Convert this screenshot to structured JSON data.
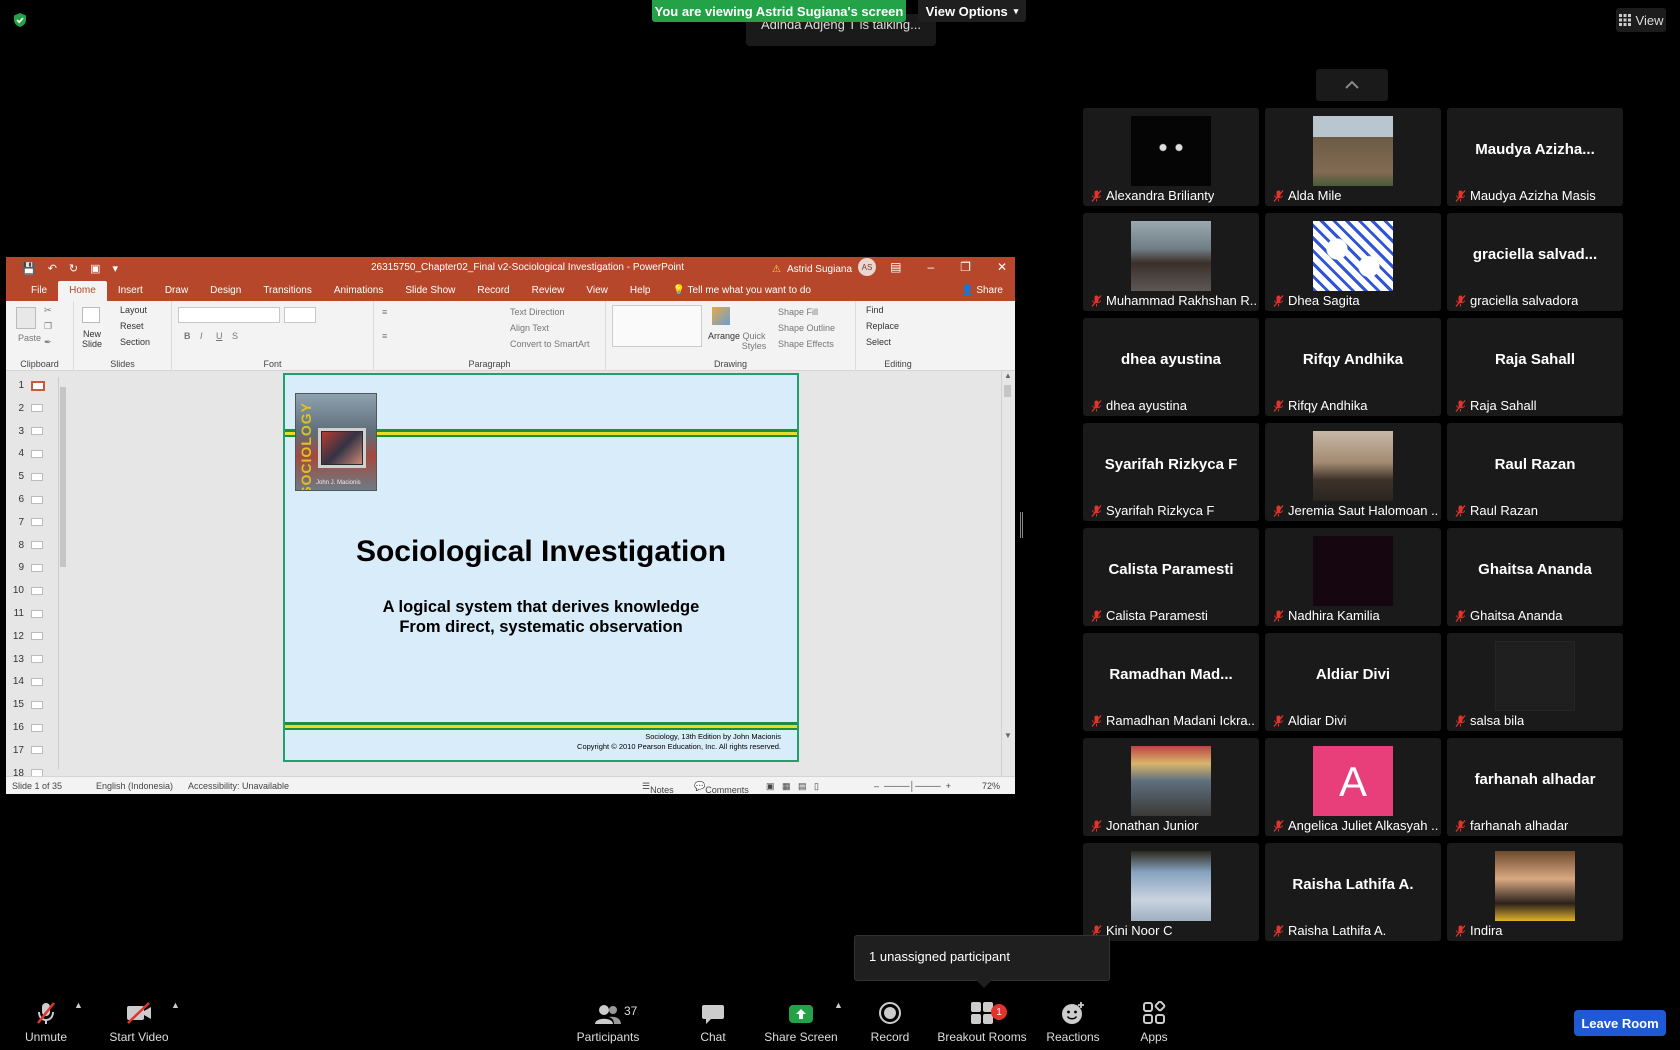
{
  "top": {
    "banner": "You are viewing Astrid Sugiana's screen",
    "view_options": "View Options",
    "talking": "Adinda Adjeng T is talking...",
    "view_label": "View"
  },
  "ppt": {
    "doc_title": "26315750_Chapter02_Final v2-Sociological Investigation  -  PowerPoint",
    "user_name": "Astrid Sugiana",
    "user_initials": "AS",
    "tabs": [
      "File",
      "Home",
      "Insert",
      "Draw",
      "Design",
      "Transitions",
      "Animations",
      "Slide Show",
      "Record",
      "Review",
      "View",
      "Help",
      "Tell me what you want to do"
    ],
    "share": "Share",
    "ribbon": {
      "paste": "Paste",
      "clipboard": "Clipboard",
      "new_slide": "New Slide",
      "layout": "Layout",
      "reset": "Reset",
      "section": "Section",
      "slides": "Slides",
      "font": "Font",
      "text_direction": "Text Direction",
      "align_text": "Align Text",
      "convert_smartart": "Convert to SmartArt",
      "paragraph": "Paragraph",
      "arrange": "Arrange",
      "quick_styles": "Quick Styles",
      "shape_fill": "Shape Fill",
      "shape_outline": "Shape Outline",
      "shape_effects": "Shape Effects",
      "drawing": "Drawing",
      "find": "Find",
      "replace": "Replace",
      "select": "Select",
      "editing": "Editing"
    },
    "thumb_numbers": [
      "1",
      "2",
      "3",
      "4",
      "5",
      "6",
      "7",
      "8",
      "9",
      "10",
      "11",
      "12",
      "13",
      "14",
      "15",
      "16",
      "17",
      "18"
    ],
    "slide": {
      "book_spine": "SOCIOLOGY",
      "book_author": "John J. Macionis",
      "title": "Sociological Investigation",
      "sub1": "A logical system that derives knowledge",
      "sub2": "From direct, systematic observation",
      "foot1": "Sociology, 13th Edition by John Macionis",
      "foot2": "Copyright © 2010 Pearson Education, Inc.  All rights reserved."
    },
    "status": {
      "slide_of": "Slide 1 of 35",
      "language": "English (Indonesia)",
      "accessibility": "Accessibility: Unavailable",
      "notes": "Notes",
      "comments": "Comments",
      "zoom": "72%"
    }
  },
  "participants": [
    {
      "name": "Alexandra Brilianty",
      "big": "",
      "photo": "cat"
    },
    {
      "name": "Alda Mile",
      "big": "",
      "photo": "building"
    },
    {
      "name": "Maudya Azizha Masis",
      "big": "Maudya  Azizha...",
      "photo": ""
    },
    {
      "name": "Muhammad Rakhshan R...",
      "big": "",
      "photo": "bike"
    },
    {
      "name": "Dhea Sagita",
      "big": "",
      "photo": "bear"
    },
    {
      "name": "graciella salvadora",
      "big": "graciella  salvad...",
      "photo": ""
    },
    {
      "name": "dhea ayustina",
      "big": "dhea ayustina",
      "photo": ""
    },
    {
      "name": "Rifqy Andhika",
      "big": "Rifqy Andhika",
      "photo": ""
    },
    {
      "name": "Raja Sahall",
      "big": "Raja Sahall",
      "photo": ""
    },
    {
      "name": "Syarifah Rizkyca F",
      "big": "Syarifah Rizkyca F",
      "photo": ""
    },
    {
      "name": "Jeremia Saut Halomoan ...",
      "big": "",
      "photo": "man"
    },
    {
      "name": "Raul Razan",
      "big": "Raul Razan",
      "photo": ""
    },
    {
      "name": "Calista Paramesti",
      "big": "Calista Paramesti",
      "photo": ""
    },
    {
      "name": "Nadhira Kamilia",
      "big": "",
      "photo": "dark"
    },
    {
      "name": "Ghaitsa Ananda",
      "big": "Ghaitsa Ananda",
      "photo": ""
    },
    {
      "name": "Ramadhan Madani Ickra...",
      "big": "Ramadhan  Mad...",
      "photo": ""
    },
    {
      "name": "Aldiar Divi",
      "big": "Aldiar Divi",
      "photo": ""
    },
    {
      "name": "salsa bila",
      "big": "",
      "photo": "blank"
    },
    {
      "name": "Jonathan Junior",
      "big": "",
      "photo": "room"
    },
    {
      "name": "Angelica Juliet Alkasyah ...",
      "big": "",
      "photo": "letterA"
    },
    {
      "name": "farhanah alhadar",
      "big": "farhanah alhadar",
      "photo": ""
    },
    {
      "name": "Kini Noor C",
      "big": "",
      "photo": "sky"
    },
    {
      "name": "Raisha Lathifa A.",
      "big": "Raisha Lathifa A.",
      "photo": ""
    },
    {
      "name": "Indira",
      "big": "",
      "photo": "woman"
    }
  ],
  "avatar_letter": "A",
  "unassigned": "1 unassigned participant",
  "toolbar": {
    "unmute": "Unmute",
    "start_video": "Start Video",
    "participants": "Participants",
    "participants_count": "37",
    "chat": "Chat",
    "share_screen": "Share Screen",
    "record": "Record",
    "breakout_rooms": "Breakout Rooms",
    "breakout_badge": "1",
    "reactions": "Reactions",
    "apps": "Apps",
    "leave_room": "Leave Room"
  },
  "colors": {
    "ppt_accent": "#b7472a",
    "banner_green": "#23a248",
    "share_green": "#23a248",
    "leave_blue": "#1f5ad6",
    "mute_red": "#e0342d"
  }
}
